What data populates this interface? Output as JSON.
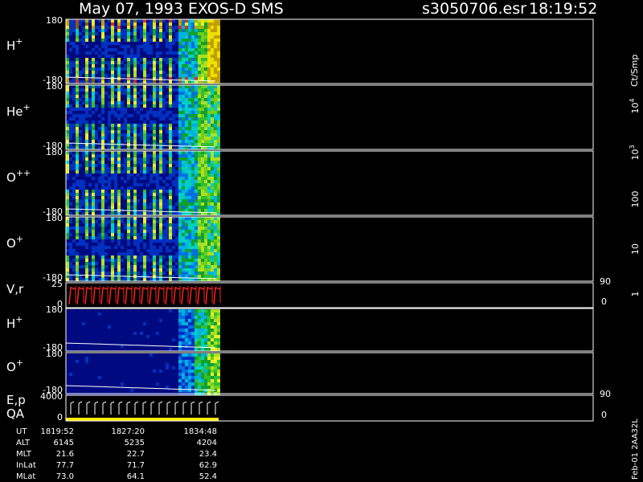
{
  "header": {
    "title": "May 07, 1993   EXOS-D SMS",
    "file": "s3050706.esr",
    "time": "18:19:52"
  },
  "colors": {
    "background": "#000000",
    "panel_fill": "#000a80",
    "trace": "#ff2020",
    "qa_bar": "#ffee00",
    "colorbar": [
      "#000a80",
      "#0030c0",
      "#0070e0",
      "#00b0e0",
      "#00d0c0",
      "#10a030",
      "#30c030",
      "#70d020",
      "#b0e020",
      "#e8f020",
      "#f0e000",
      "#c0a000",
      "#806000",
      "#d03020",
      "#b00000",
      "#800000",
      "#ffffff"
    ]
  },
  "chart_data": {
    "type": "heatmap",
    "time_labels": [
      "1819:52",
      "1827:20",
      "1834:48"
    ],
    "panels": [
      {
        "label": "H",
        "sup": "+",
        "y_top": "180",
        "y_bottom": "-180"
      },
      {
        "label": "He",
        "sup": "+",
        "y_top": "180",
        "y_bottom": "-180"
      },
      {
        "label": "O",
        "sup": "++",
        "y_top": "180",
        "y_bottom": "-180"
      },
      {
        "label": "O",
        "sup": "+",
        "y_top": "180",
        "y_bottom": "-180"
      },
      {
        "label": "V,r",
        "sup": "",
        "y_top": "25",
        "y_bottom": "0",
        "right_top": "90",
        "right_bottom": "0"
      },
      {
        "label": "H",
        "sup": "+",
        "y_top": "180",
        "y_bottom": "-180"
      },
      {
        "label": "O",
        "sup": "+",
        "y_top": "180",
        "y_bottom": "-180"
      },
      {
        "label": "E,p",
        "sup": "",
        "label2": "QA",
        "y_top": "4000",
        "y_bottom": "0",
        "right_top": "90",
        "right_bottom": "0"
      }
    ],
    "colorbar": {
      "label": "Ct/Smp",
      "ticks": [
        {
          "base": "1",
          "sup": ""
        },
        {
          "base": "10",
          "sup": ""
        },
        {
          "base": "100",
          "sup": ""
        },
        {
          "base": "10",
          "sup": "3"
        },
        {
          "base": "10",
          "sup": "4"
        }
      ]
    },
    "ephemeris": {
      "rows": [
        {
          "name": "UT",
          "values": [
            "1819:52",
            "1827:20",
            "1834:48"
          ]
        },
        {
          "name": "ALT",
          "values": [
            "6145",
            "5235",
            "4204"
          ]
        },
        {
          "name": "MLT",
          "values": [
            "21.6",
            "22.7",
            "23.4"
          ]
        },
        {
          "name": "InLat",
          "values": [
            "77.7",
            "71.7",
            "62.9"
          ]
        },
        {
          "name": "MLat",
          "values": [
            "73.0",
            "64.1",
            "52.4"
          ]
        }
      ]
    },
    "footer_note": "Feb-01 2AA32L"
  }
}
